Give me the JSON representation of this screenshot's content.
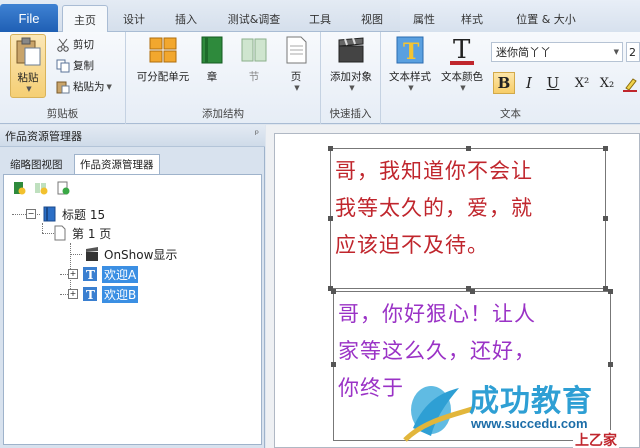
{
  "tabs": {
    "file": "File",
    "items": [
      "主页",
      "设计",
      "插入",
      "测试&调查",
      "工具",
      "视图",
      "属性",
      "样式",
      "位置 & 大小"
    ]
  },
  "ribbon": {
    "clipboard": {
      "paste": "粘贴",
      "cut": "剪切",
      "copy": "复制",
      "paste_as": "粘贴为",
      "label": "剪贴板"
    },
    "structure": {
      "splittable": "可分配单元",
      "chapter": "章",
      "section": "节",
      "page": "页",
      "label": "添加结构"
    },
    "quick": {
      "add_object": "添加对象",
      "label": "快速插入"
    },
    "text": {
      "text_style": "文本样式",
      "text_color": "文本颜色",
      "font_name": "迷你简丫丫",
      "font_size": "2",
      "bold": "B",
      "italic": "I",
      "underline": "U",
      "superscript": "X²",
      "subscript": "X₂",
      "label": "文本"
    }
  },
  "pane": {
    "title": "作品资源管理器",
    "pin": "ᵖ",
    "tab_thumb": "缩略图视图",
    "tab_explorer": "作品资源管理器",
    "tree": {
      "root": "标题 15",
      "page": "第 1 页",
      "onshow": "OnShow显示",
      "item_a": "欢迎A",
      "item_b": "欢迎B"
    }
  },
  "canvas": {
    "box1": [
      "哥，我知道你不会让",
      "我等太久的，爱，就",
      "应该迫不及待。"
    ],
    "box2": [
      "哥，你好狠心！让人",
      "家等这么久，还好，",
      "你终于"
    ]
  },
  "watermark": {
    "brand": "成功教育",
    "url": "www.succedu.com",
    "corner": "上乙家"
  },
  "colors": {
    "accent": "#1f5fb4",
    "box1_text": "#c0262d",
    "box2_text": "#9a32c6",
    "selection": "#3b8fe3"
  }
}
